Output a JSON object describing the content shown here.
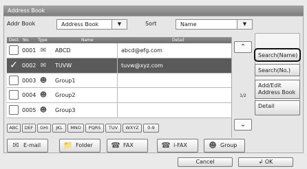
{
  "window": {
    "title": "Address Book"
  },
  "filter": {
    "addr_book_label": "Addr Book",
    "addr_book_value": "Address Book",
    "sort_label": "Sort",
    "sort_value": "Name"
  },
  "table": {
    "headers": {
      "dest": "Dest.",
      "no": "No.",
      "type": "Type",
      "name": "Name",
      "detail": "Detail"
    },
    "rows": [
      {
        "no": "0001",
        "type": "email-icon",
        "name": "ABCD",
        "detail": "abcd@efg.com",
        "checked": false
      },
      {
        "no": "0002",
        "type": "email-icon",
        "name": "TUVW",
        "detail": "tuvw@xyz.com",
        "checked": true
      },
      {
        "no": "0003",
        "type": "group-icon",
        "name": "Group1",
        "detail": "",
        "checked": false
      },
      {
        "no": "0004",
        "type": "group-icon",
        "name": "Group2",
        "detail": "",
        "checked": false
      },
      {
        "no": "0005",
        "type": "group-icon",
        "name": "Group3",
        "detail": "",
        "checked": false
      }
    ]
  },
  "pager": {
    "page": "1/2"
  },
  "side_buttons": {
    "search_name": "Search(Name)",
    "search_no": "Search(No.)",
    "add_edit_1": "Add/Edit",
    "add_edit_2": "Address Book",
    "detail": "Detail"
  },
  "index_tabs": [
    "ABC",
    "DEF",
    "GHI",
    "JKL",
    "MNO",
    "PQRS",
    "TUV",
    "WXYZ",
    "0-9"
  ],
  "type_buttons": {
    "email": "E-mail",
    "folder": "Folder",
    "fax": "FAX",
    "ifax": "i-FAX",
    "group": "Group"
  },
  "footer": {
    "cancel": "Cancel",
    "ok": "OK"
  }
}
